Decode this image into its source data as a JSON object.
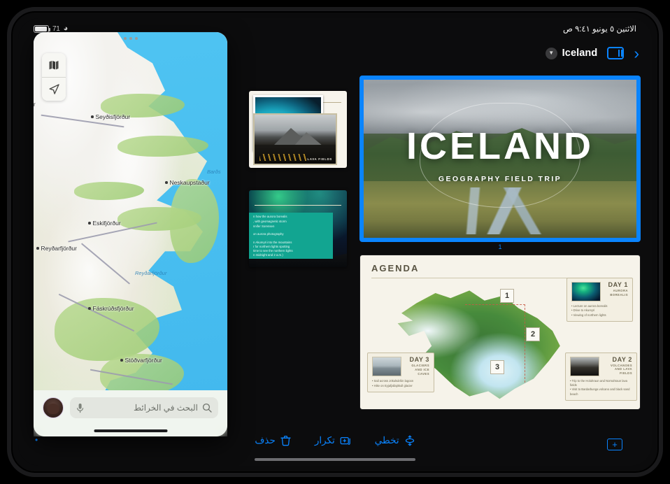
{
  "status_bar": {
    "battery_percent": "71",
    "wifi_icon": "wifi-icon",
    "datetime": "الاثنين ٥ يونيو   ٩:٤١ ص"
  },
  "app_toolbar": {
    "document_title": "Iceland",
    "chevron_icon": "chevron-down-icon",
    "view_options_icon": "view-options-icon",
    "play_icon": "play-chevron-icon"
  },
  "bottom_toolbar": {
    "items": [
      {
        "label": "تخطي",
        "icon": "skip-slide-icon"
      },
      {
        "label": "تكرار",
        "icon": "duplicate-slide-icon"
      },
      {
        "label": "حذف",
        "icon": "trash-icon"
      }
    ],
    "add_slide_icon": "add-slide-icon",
    "add_slide_label": "+"
  },
  "navigator_slides": [
    {
      "name": "lava-fields-slide",
      "caption": "LAVA FIELDS"
    },
    {
      "name": "aurora-slide",
      "lines": [
        "n how the aurora borealis",
        ", with geomagnetic storm",
        "nnifer Sorensen",
        "on aurora photography",
        "n Akureyri into the mountains",
        "r for northern lights spotting",
        "time to see the northern lights",
        "n midnight and 2 a.m.)"
      ]
    }
  ],
  "stage": {
    "title_slide": {
      "title": "ICELAND",
      "subtitle": "GEOGRAPHY FIELD TRIP",
      "slide_number": "1",
      "selection_color": "#0a84ff"
    },
    "agenda_slide": {
      "title": "AGENDA",
      "pins": [
        "1",
        "2",
        "3"
      ],
      "cards": [
        {
          "day": "DAY 1",
          "subtitle": "AURORA BOREALIS",
          "thumb": "aurora-thumbnail",
          "bullets": [
            "• Lecture on aurora borealis",
            "• Drive to Akureyri",
            "• Viewing of northern lights"
          ]
        },
        {
          "day": "DAY 2",
          "subtitle": "VOLCANOES AND LAVA FIELDS",
          "thumb": "lava-thumbnail",
          "bullets": [
            "• Trip to the Holuhraun and Nornahraun lava fields",
            "• Visit to Bardarbunga volcano and black sand beach"
          ]
        },
        {
          "day": "DAY 3",
          "subtitle": "GLACIERS AND ICE CAVES",
          "thumb": "glacier-thumbnail",
          "bullets": [
            "• Sail across Jökulsárlón lagoon",
            "• Hike on Eyjafjallajökull glacier"
          ]
        }
      ]
    }
  },
  "maps_panel": {
    "grabber_icon": "drag-handle-icon",
    "controls": [
      {
        "icon": "map-type-icon"
      },
      {
        "icon": "current-location-icon"
      }
    ],
    "search": {
      "placeholder": "البحث في الخرائط",
      "search_icon": "search-icon",
      "mic_icon": "microphone-icon",
      "avatar": "user-avatar"
    },
    "places": [
      {
        "label": "Seyðisfjörður"
      },
      {
        "label": "Neskaupstaður"
      },
      {
        "label": "Eskifjörður"
      },
      {
        "label": "Reyðarfjörður"
      },
      {
        "label": "Fáskrúðsfjörður"
      },
      {
        "label": "Stöðvarfjörður"
      }
    ],
    "water_labels": [
      {
        "label": "Barðs"
      },
      {
        "label": "Reyðarfjörður"
      }
    ],
    "edge_label": "ir"
  }
}
